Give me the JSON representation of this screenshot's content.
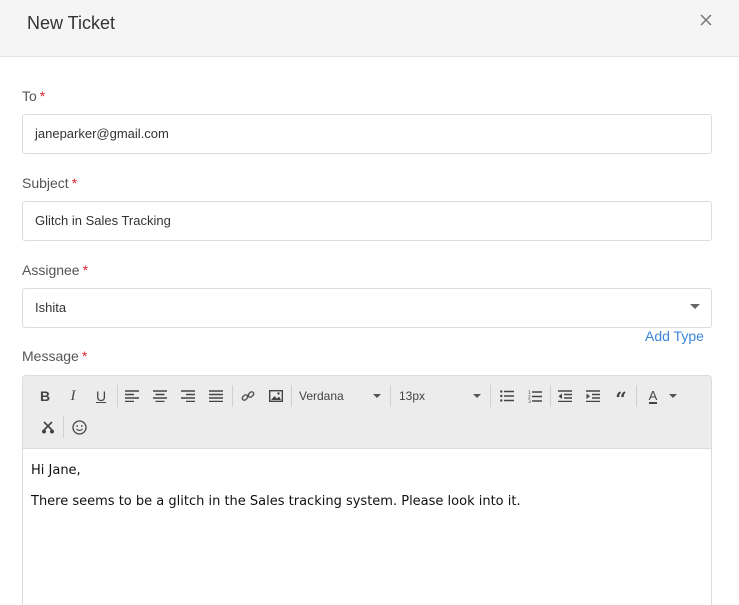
{
  "dialog": {
    "title": "New Ticket",
    "close_icon": "close-icon"
  },
  "form": {
    "to": {
      "label": "To",
      "required": "*",
      "value": "janeparker@gmail.com"
    },
    "subject": {
      "label": "Subject",
      "required": "*",
      "value": "Glitch in Sales Tracking"
    },
    "assignee": {
      "label": "Assignee",
      "required": "*",
      "value": "Ishita"
    },
    "add_type": "Add Type",
    "message": {
      "label": "Message",
      "required": "*",
      "font_family": "Verdana",
      "font_size": "13px",
      "body_lines": [
        "Hi Jane,",
        "There seems to be a glitch in the Sales tracking system. Please look into it."
      ]
    }
  },
  "toolbar_icons": [
    "bold-icon",
    "italic-icon",
    "underline-icon",
    "align-left-icon",
    "align-center-icon",
    "align-right-icon",
    "align-justify-icon",
    "link-icon",
    "image-icon",
    "bullet-list-icon",
    "numbered-list-icon",
    "outdent-icon",
    "indent-icon",
    "blockquote-icon",
    "font-color-icon",
    "cut-icon",
    "emoji-icon"
  ],
  "colors": {
    "accent": "#3b86d9",
    "required": "#d9262f",
    "header_bg": "#f5f5f5",
    "toolbar_bg": "#ececec"
  }
}
